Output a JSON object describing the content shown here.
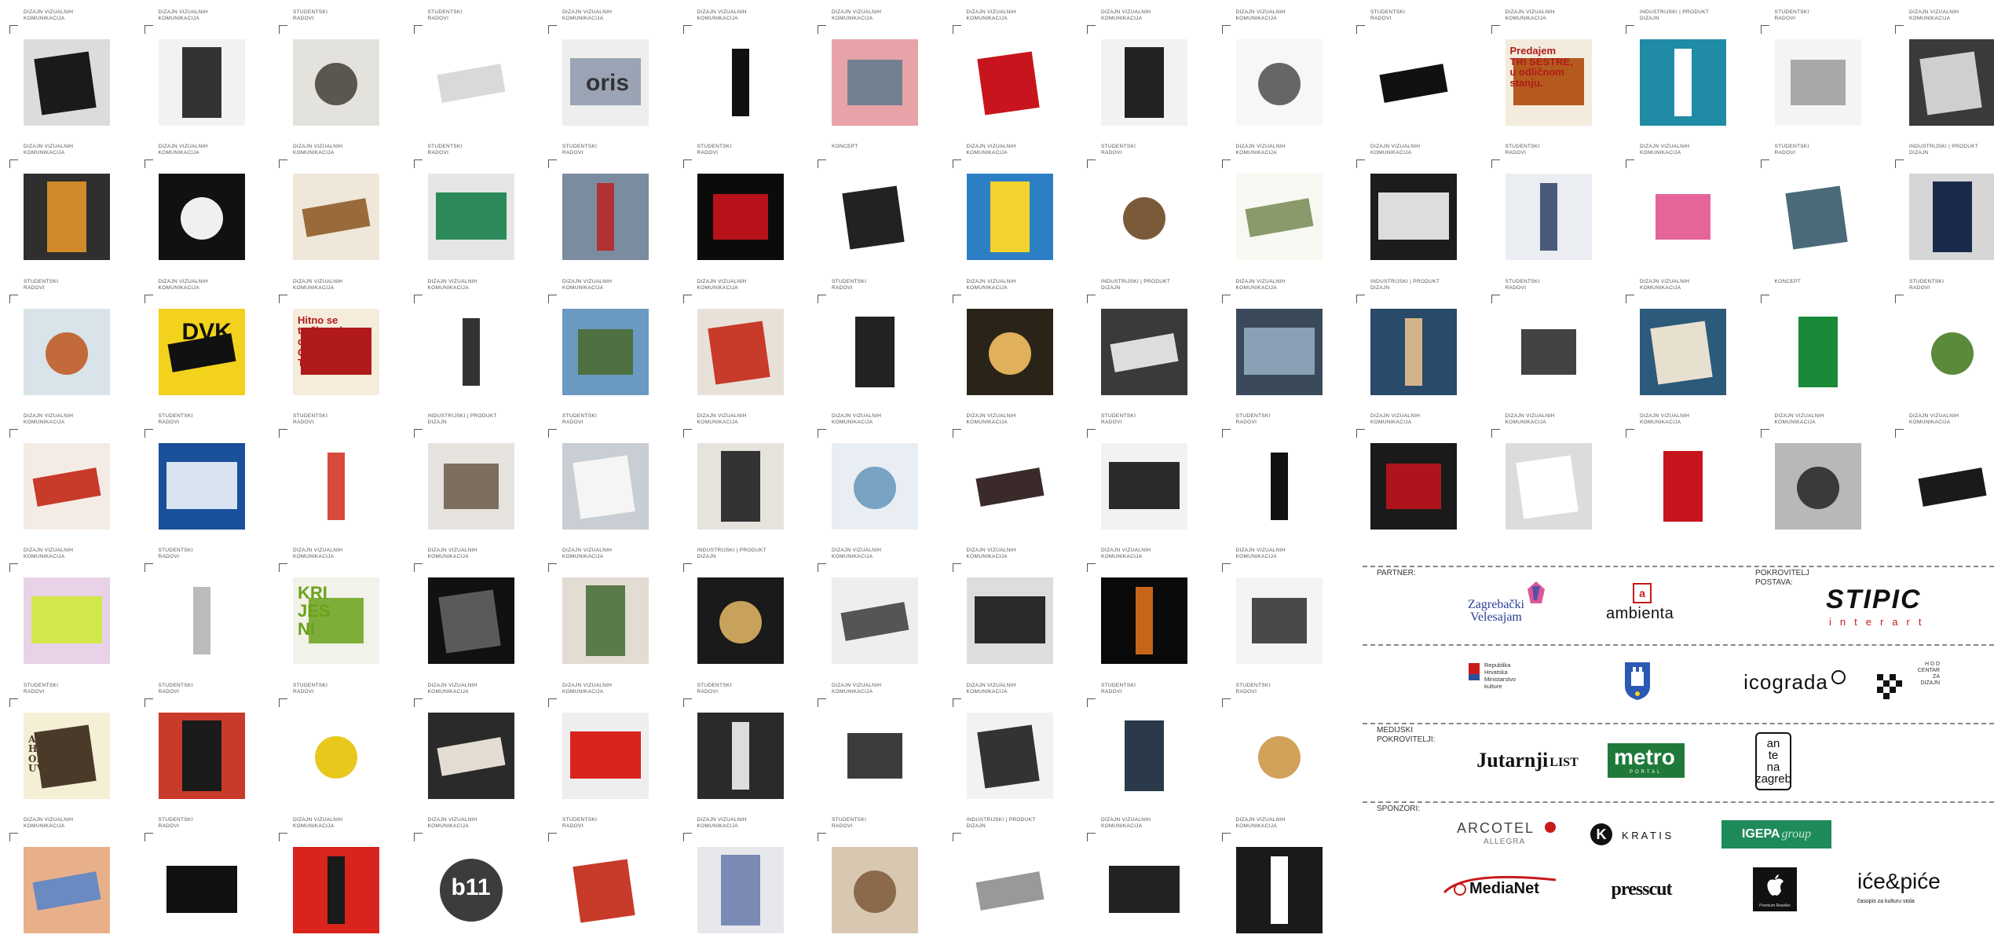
{
  "categories": {
    "dvk": "DIZAJN VIZUALNIH\nKOMUNIKACIJA",
    "sr": "STUDENTSKI\nRADOVI",
    "ipd": "INDUSTRIJSKI | PRODUKT\nDIZAJN",
    "k": "KONCEPT"
  },
  "tiles": [
    {
      "cat": "dvk",
      "bg": "#dcdcdc",
      "fg": "#1a1a1a"
    },
    {
      "cat": "dvk",
      "bg": "#f2f2f2",
      "fg": "#333333"
    },
    {
      "cat": "sr",
      "bg": "#e4e2dc",
      "fg": "#5b5650"
    },
    {
      "cat": "sr",
      "bg": "#ffffff",
      "fg": "#d9d9d9"
    },
    {
      "cat": "dvk",
      "bg": "#eeeeee",
      "fg": "#9aa4b5"
    },
    {
      "cat": "dvk",
      "bg": "#ffffff",
      "fg": "#111111"
    },
    {
      "cat": "dvk",
      "bg": "#e8a3a8",
      "fg": "#5e7a8e"
    },
    {
      "cat": "dvk",
      "bg": "#ffffff",
      "fg": "#c8141c"
    },
    {
      "cat": "dvk",
      "bg": "#f2f2f2",
      "fg": "#222222"
    },
    {
      "cat": "dvk",
      "bg": "#f7f7f7",
      "fg": "#666666"
    },
    {
      "cat": "sr",
      "bg": "#ffffff",
      "fg": "#111111"
    },
    {
      "cat": "dvk",
      "bg": "#f3ecdc",
      "fg": "#b45a1e"
    },
    {
      "cat": "ipd",
      "bg": "#1f8ba5",
      "fg": "#ffffff"
    },
    {
      "cat": "sr",
      "bg": "#f4f4f4",
      "fg": "#9a9a9a"
    },
    {
      "cat": "dvk",
      "bg": "#3a3a3a",
      "fg": "#cfcfcf"
    },
    {
      "cat": "dvk",
      "bg": "#2f2f2f",
      "fg": "#d08a2a"
    },
    {
      "cat": "dvk",
      "bg": "#111111",
      "fg": "#f0f0f0"
    },
    {
      "cat": "dvk",
      "bg": "#efe7da",
      "fg": "#9a6b3a"
    },
    {
      "cat": "sr",
      "bg": "#e6e6e6",
      "fg": "#2c8a5a"
    },
    {
      "cat": "sr",
      "bg": "#7b8ca0",
      "fg": "#b03232"
    },
    {
      "cat": "sr",
      "bg": "#0b0b0b",
      "fg": "#d6141c"
    },
    {
      "cat": "k",
      "bg": "#ffffff",
      "fg": "#222222"
    },
    {
      "cat": "dvk",
      "bg": "#2c7fc4",
      "fg": "#f2d22c"
    },
    {
      "cat": "sr",
      "bg": "#ffffff",
      "fg": "#7b5a3a"
    },
    {
      "cat": "dvk",
      "bg": "#f8f8f2",
      "fg": "#8a9a6a"
    },
    {
      "cat": "dvk",
      "bg": "#1c1c1c",
      "fg": "#dddddd"
    },
    {
      "cat": "sr",
      "bg": "#eaedf2",
      "fg": "#4a5a7a"
    },
    {
      "cat": "dvk",
      "bg": "#ffffff",
      "fg": "#e04a8a"
    },
    {
      "cat": "sr",
      "bg": "#ffffff",
      "fg": "#4a6a7a"
    },
    {
      "cat": "ipd",
      "bg": "#d6d6d6",
      "fg": "#1a2a4a"
    },
    {
      "cat": "sr",
      "bg": "#d9e3ea",
      "fg": "#c36a3a"
    },
    {
      "cat": "dvk",
      "bg": "#f2d21c",
      "fg": "#111111"
    },
    {
      "cat": "dvk",
      "bg": "#f5ecdc",
      "fg": "#b01a1a"
    },
    {
      "cat": "dvk",
      "bg": "#ffffff",
      "fg": "#333333"
    },
    {
      "cat": "dvk",
      "bg": "#6a9ac2",
      "fg": "#4a6a2a"
    },
    {
      "cat": "dvk",
      "bg": "#e8e1d8",
      "fg": "#c83a2a"
    },
    {
      "cat": "sr",
      "bg": "#ffffff",
      "fg": "#222222"
    },
    {
      "cat": "dvk",
      "bg": "#2a2418",
      "fg": "#e0b05a"
    },
    {
      "cat": "ipd",
      "bg": "#3a3a3a",
      "fg": "#dddddd"
    },
    {
      "cat": "dvk",
      "bg": "#3a4a5a",
      "fg": "#8aa0b4"
    },
    {
      "cat": "ipd",
      "bg": "#2a4a6a",
      "fg": "#d2b48a"
    },
    {
      "cat": "sr",
      "bg": "#ffffff",
      "fg": "#222222"
    },
    {
      "cat": "dvk",
      "bg": "#2c5a7a",
      "fg": "#e8e0cf"
    },
    {
      "cat": "k",
      "bg": "#ffffff",
      "fg": "#1a8a3a"
    },
    {
      "cat": "sr",
      "bg": "#ffffff",
      "fg": "#5a8a3a"
    },
    {
      "cat": "dvk",
      "bg": "#f4ece4",
      "fg": "#c83a2a"
    },
    {
      "cat": "sr",
      "bg": "#1a4f9a",
      "fg": "#d8e4f2"
    },
    {
      "cat": "sr",
      "bg": "#ffffff",
      "fg": "#d84a3a"
    },
    {
      "cat": "ipd",
      "bg": "#e6e3de",
      "fg": "#6a5a4a"
    },
    {
      "cat": "sr",
      "bg": "#c9ced4",
      "fg": "#f5f5f5"
    },
    {
      "cat": "dvk",
      "bg": "#e6e2dc",
      "fg": "#333333"
    },
    {
      "cat": "dvk",
      "bg": "#e8eef4",
      "fg": "#7aa2c2"
    },
    {
      "cat": "dvk",
      "bg": "#ffffff",
      "fg": "#3a2a2a"
    },
    {
      "cat": "sr",
      "bg": "#f2f2f2",
      "fg": "#2a2a2a"
    },
    {
      "cat": "sr",
      "bg": "#ffffff",
      "fg": "#111111"
    },
    {
      "cat": "dvk",
      "bg": "#1a1a1a",
      "fg": "#c8141c"
    },
    {
      "cat": "dvk",
      "bg": "#dcdcdc",
      "fg": "#ffffff"
    },
    {
      "cat": "dvk",
      "bg": "#ffffff",
      "fg": "#c8141c"
    },
    {
      "cat": "dvk",
      "bg": "#b8b8b8",
      "fg": "#3a3a3a"
    },
    {
      "cat": "dvk",
      "bg": "#ffffff",
      "fg": "#1a1a1a"
    },
    {
      "cat": "dvk",
      "bg": "#e8d2e8",
      "fg": "#d2e84a"
    },
    {
      "cat": "sr",
      "bg": "#ffffff",
      "fg": "#bbbbbb"
    },
    {
      "cat": "dvk",
      "bg": "#f2f2ea",
      "fg": "#6aa21a"
    },
    {
      "cat": "dvk",
      "bg": "#111111",
      "fg": "#5a5a5a"
    },
    {
      "cat": "dvk",
      "bg": "#e2dcd2",
      "fg": "#5a7a4a"
    },
    {
      "cat": "ipd",
      "bg": "#1a1a1a",
      "fg": "#c8a25a"
    },
    {
      "cat": "dvk",
      "bg": "#eeeeee",
      "fg": "#555555"
    },
    {
      "cat": "dvk",
      "bg": "#dddddd",
      "fg": "#2a2a2a"
    },
    {
      "cat": "dvk",
      "bg": "#0a0a0a",
      "fg": "#c8641a"
    },
    {
      "cat": "dvk",
      "bg": "#f4f4f4",
      "fg": "#2a2a2a"
    },
    {
      "cat": "sr",
      "bg": "#f5efd6",
      "fg": "#4a3a2a"
    },
    {
      "cat": "sr",
      "bg": "#c83a2a",
      "fg": "#1a1a1a"
    },
    {
      "cat": "sr",
      "bg": "#ffffff",
      "fg": "#e8c81c"
    },
    {
      "cat": "dvk",
      "bg": "#2a2a2a",
      "fg": "#e2dcd2"
    },
    {
      "cat": "dvk",
      "bg": "#eeeeee",
      "fg": "#d8241c"
    },
    {
      "cat": "sr",
      "bg": "#2a2a2a",
      "fg": "#dddddd"
    },
    {
      "cat": "dvk",
      "bg": "#ffffff",
      "fg": "#1a1a1a"
    },
    {
      "cat": "dvk",
      "bg": "#f2f2f2",
      "fg": "#333333"
    },
    {
      "cat": "sr",
      "bg": "#ffffff",
      "fg": "#2a3a4a"
    },
    {
      "cat": "sr",
      "bg": "#ffffff",
      "fg": "#d2a25a"
    },
    {
      "cat": "dvk",
      "bg": "#e8b08a",
      "fg": "#6a8ac2"
    },
    {
      "cat": "sr",
      "bg": "#ffffff",
      "fg": "#111111"
    },
    {
      "cat": "dvk",
      "bg": "#d8241c",
      "fg": "#1a1a1a"
    },
    {
      "cat": "dvk",
      "bg": "#ffffff",
      "fg": "#1a1a1a"
    },
    {
      "cat": "sr",
      "bg": "#ffffff",
      "fg": "#c83a2a"
    },
    {
      "cat": "dvk",
      "bg": "#e6e8ec",
      "fg": "#7a8ab4"
    },
    {
      "cat": "sr",
      "bg": "#d8c8b2",
      "fg": "#8a6a4a"
    },
    {
      "cat": "ipd",
      "bg": "#ffffff",
      "fg": "#999999"
    },
    {
      "cat": "dvk",
      "bg": "#ffffff",
      "fg": "#222222"
    },
    {
      "cat": "dvk",
      "bg": "#1a1a1a",
      "fg": "#ffffff"
    }
  ],
  "thumb_texts": {
    "oris": "oris",
    "dvk": "DVK",
    "b11": "b11",
    "trisestre": "Predajem\nTRI SESTRE,\nu odličnom\nstanju.",
    "oliver": "Hitno se\ntraži novi\ndom za\nOLIVERA\nTWISTA.",
    "krijes": "KRI\nJES\nNI",
    "alphabet": "ABCDEFG\nHIJKLMN\nOPQRST\nUVWXYZ"
  },
  "panel": {
    "partner_label": "PARTNER:",
    "pokrovitelj_label": "POKROVITELJ\nPOSTAVA:",
    "medijski_label": "MEDIJSKI\nPOKROVITELJI:",
    "sponzori_label": "SPONZORI:",
    "logos": {
      "zv": "Zagrebački\nVelesajam",
      "ambienta": "ambienta",
      "stipic_main": "STIPIC",
      "stipic_sub": "interart",
      "ministarstvo": "Republika\nHrvatska\nMinistarstvo\nkulture",
      "icograda": "icograda",
      "hdd": "H D D\nCENTAR\nZA\nDIZAJN",
      "jutarnji": "Jutarnji",
      "jutarnji_list": "LIST",
      "metro": "metro",
      "metro_sub": "PORTAL",
      "antena": "an\nte\nna\nzagreb",
      "arcotel": "ARCOTEL",
      "allegra": "ALLEGRA",
      "kratis": "K R A T I S",
      "igepa": "IGEPA",
      "igepa_group": "group",
      "medianet": "MediaNet",
      "presscut": "presscut",
      "apple": "Premium Reseller",
      "icepice": "iće&piće",
      "icepice_sub": "časopis za kulturu stola"
    }
  }
}
